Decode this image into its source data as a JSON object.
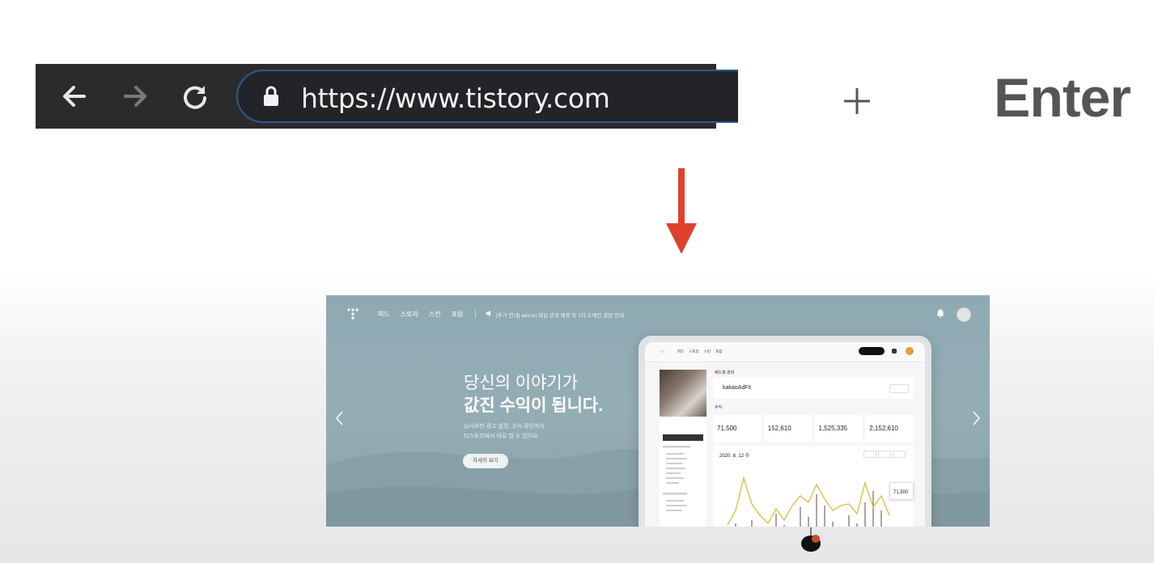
{
  "browser": {
    "url": "https://www.tistory.com",
    "back_label": "Back",
    "forward_label": "Forward",
    "reload_label": "Reload"
  },
  "instruction": {
    "plus": "+",
    "key": "Enter"
  },
  "colors": {
    "arrow": "#e0412a",
    "url_border": "#2b5b8f",
    "hero_bg": "#94adb5"
  },
  "tistory": {
    "nav": [
      "피드",
      "스토리",
      "스킨",
      "포럼"
    ],
    "notice": "[추가 안내] ads.txt 파일 관계 배경 및 2차 도메인 관련 안내",
    "hero_line1": "당신의 이야기가",
    "hero_line2": "값진 수익이 됩니다.",
    "hero_sub1": "심사부터 광고 설정, 수익 확인까지",
    "hero_sub2": "티스토리에서 바로 할 수 있어요.",
    "hero_button": "자세히 보기"
  },
  "tablet": {
    "nav": [
      "피드",
      "스토리",
      "스킨",
      "포럼"
    ],
    "section_title": "애드핏 관리",
    "adfit_logo": "kakaoAdFit",
    "revenue_title": "수익",
    "cards": [
      {
        "value": "71,500"
      },
      {
        "value": "152,610"
      },
      {
        "value": "1,525,335"
      },
      {
        "value": "2,152,610"
      }
    ],
    "chart_date": "2020. 8. 12 수",
    "tooltip_value": "71,500"
  }
}
